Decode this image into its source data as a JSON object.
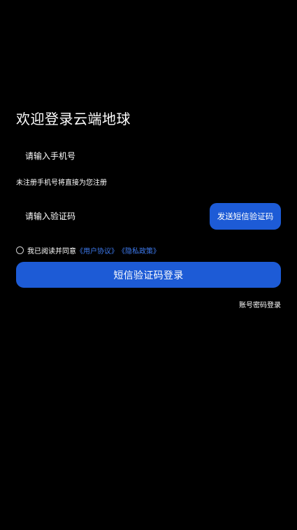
{
  "page": {
    "title": "欢迎登录云端地球"
  },
  "phone": {
    "placeholder": "请输入手机号",
    "hint": "未注册手机号将直接为您注册"
  },
  "code": {
    "placeholder": "请输入验证码",
    "send_label": "发送短信验证码"
  },
  "agreement": {
    "prefix": "我已阅读并同意",
    "user_agreement": "《用户协议》",
    "privacy_policy": "《隐私政策》",
    "checked": false
  },
  "login": {
    "submit_label": "短信验证码登录",
    "alt_login_label": "账号密码登录"
  },
  "colors": {
    "background": "#000000",
    "accent": "#1d5bd6",
    "link": "#3e7bf0",
    "text": "#ffffff"
  }
}
